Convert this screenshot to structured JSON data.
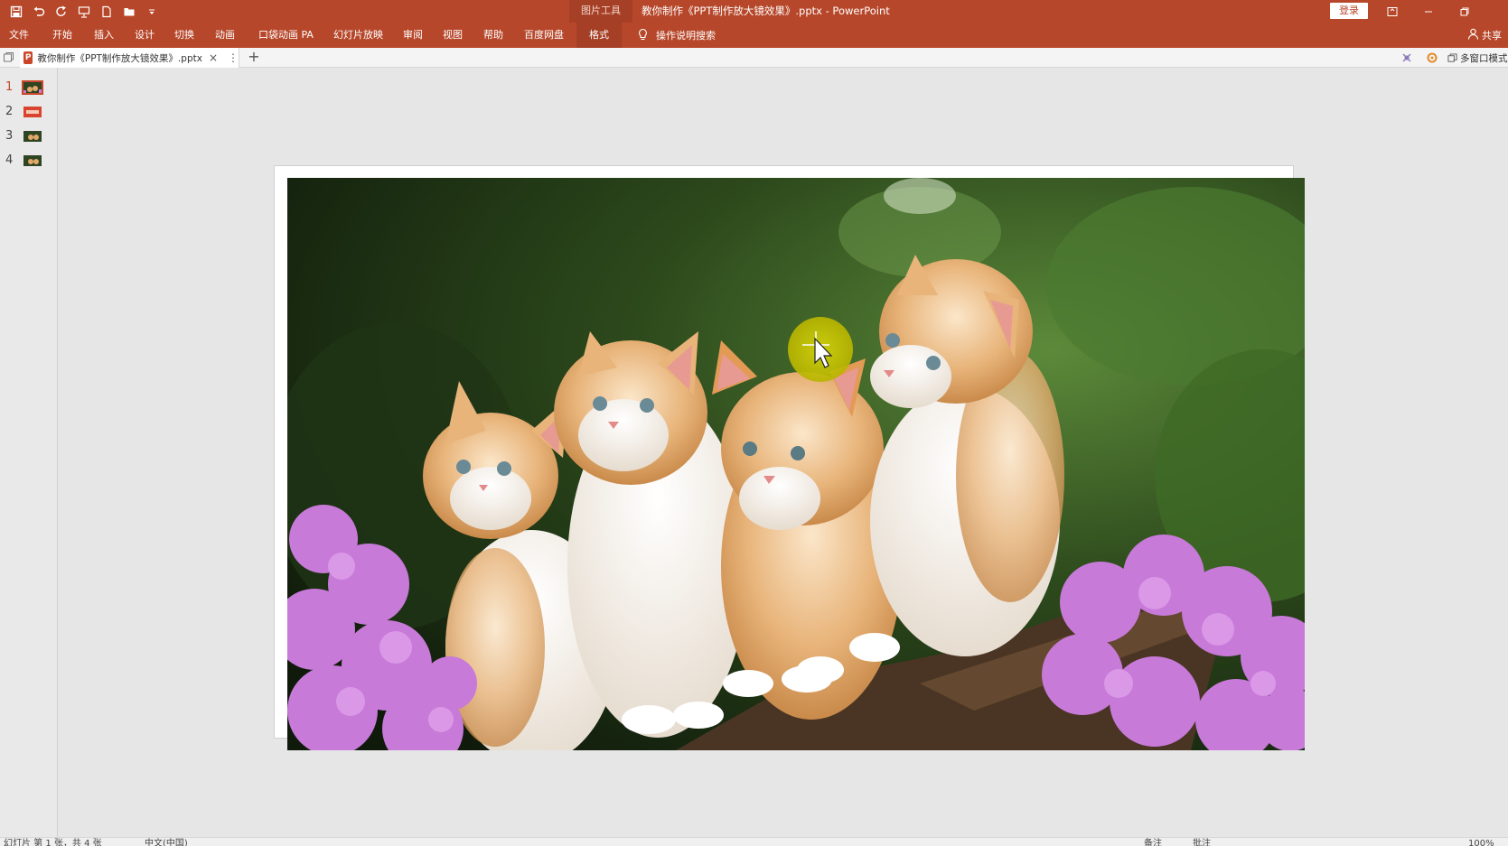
{
  "window": {
    "title": "教你制作《PPT制作放大镜效果》.pptx  -  PowerPoint",
    "contextual_tab_group": "图片工具",
    "login_label": "登录"
  },
  "ribbon": {
    "tabs": [
      "文件",
      "开始",
      "插入",
      "设计",
      "切换",
      "动画",
      "口袋动画 PA",
      "幻灯片放映",
      "审阅",
      "视图",
      "帮助",
      "百度网盘",
      "格式"
    ],
    "active_tab": "格式",
    "tell_me": "操作说明搜索",
    "share": "共享"
  },
  "doc_tab": {
    "file_name": "教你制作《PPT制作放大镜效果》.pptx",
    "new_tab_symbol": "+",
    "multi_window_label": "多窗口模式"
  },
  "thumbnails": [
    {
      "number": "1",
      "active": true
    },
    {
      "number": "2",
      "active": false
    },
    {
      "number": "3",
      "active": false
    },
    {
      "number": "4",
      "active": false
    }
  ],
  "status": {
    "slide_info": "幻灯片 第 1 张，共 4 张",
    "language": "中文(中国)",
    "notes": "备注",
    "comments": "批注",
    "zoom": "100%"
  },
  "colors": {
    "accent": "#b7472a",
    "highlight_circle": "#c8c80a"
  },
  "icons": [
    "save-icon",
    "undo-icon",
    "redo-icon",
    "present-icon",
    "new-file-icon",
    "open-icon",
    "customize-qat-icon",
    "lightbulb-icon",
    "person-icon",
    "ribbon-display-icon",
    "minimize-icon",
    "restore-icon",
    "ppt-file-icon",
    "close-icon",
    "more-icon",
    "add-tab-icon",
    "cursor-icon"
  ]
}
